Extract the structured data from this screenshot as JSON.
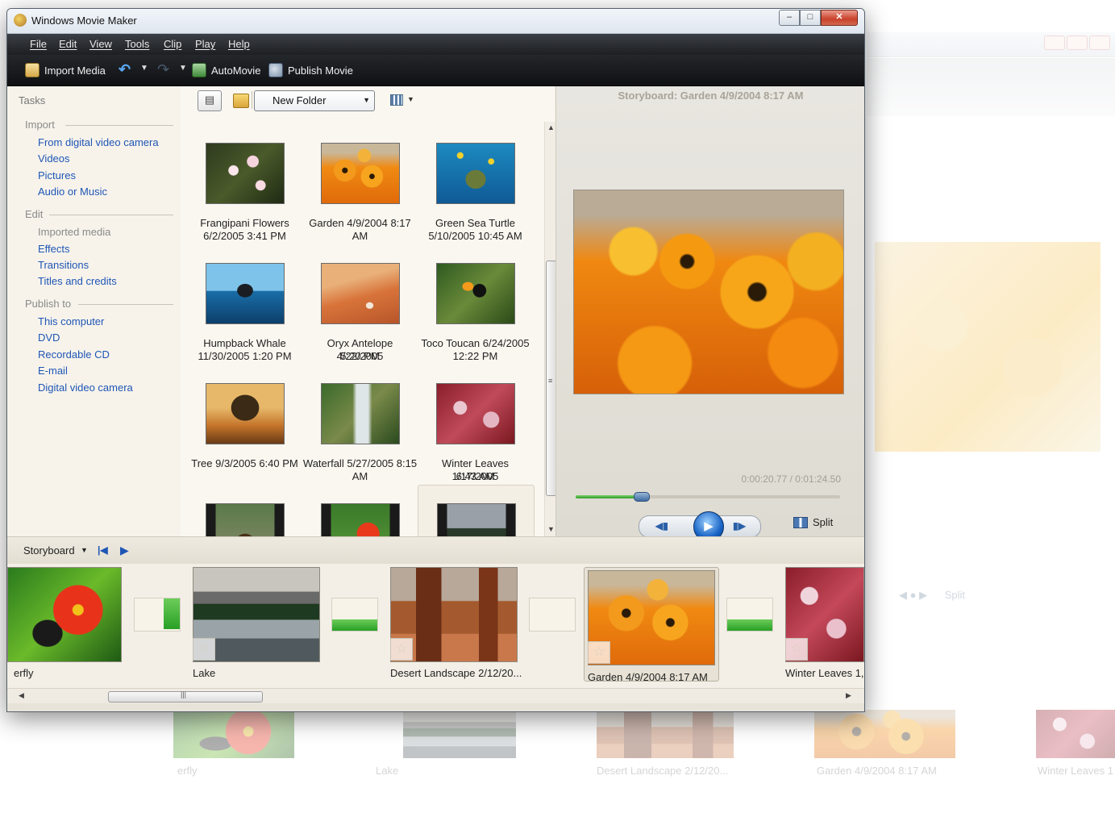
{
  "window": {
    "title": "Windows Movie Maker"
  },
  "menu": [
    "File",
    "Edit",
    "View",
    "Tools",
    "Clip",
    "Play",
    "Help"
  ],
  "toolbar": {
    "import_media": "Import Media",
    "automovie": "AutoMovie",
    "publish_movie": "Publish Movie"
  },
  "tasks": {
    "title": "Tasks",
    "import": {
      "heading": "Import",
      "items": [
        "From digital video camera",
        "Videos",
        "Pictures",
        "Audio or Music"
      ]
    },
    "edit": {
      "heading": "Edit",
      "items": [
        "Imported media",
        "Effects",
        "Transitions",
        "Titles and credits"
      ]
    },
    "publish": {
      "heading": "Publish to",
      "items": [
        "This computer",
        "DVD",
        "Recordable CD",
        "E-mail",
        "Digital video camera"
      ]
    }
  },
  "collection": {
    "folder": "New Folder",
    "items": [
      {
        "name": "Frangipani Flowers",
        "date": "6/2/2005 3:41 PM"
      },
      {
        "name": "Garden 4/9/2004 8:17",
        "date": "AM"
      },
      {
        "name": "Green Sea Turtle",
        "date": "5/10/2005 10:45 AM"
      },
      {
        "name": "Humpback Whale",
        "date": "11/30/2005 1:20 PM"
      },
      {
        "name": "Oryx Antelope 4/22/2005",
        "date": "5:20 PM"
      },
      {
        "name": "Toco Toucan 6/24/2005",
        "date": "12:22 PM"
      },
      {
        "name": "Tree 9/3/2005 6:40 PM",
        "date": ""
      },
      {
        "name": "Waterfall 5/27/2005 8:15",
        "date": "AM"
      },
      {
        "name": "Winter Leaves 1/17/2005",
        "date": "6:43 AM"
      }
    ]
  },
  "preview": {
    "title": "Storyboard: Garden 4/9/2004 8:17 AM",
    "time": "0:00:20.77 / 0:01:24.50",
    "progress": 0.246,
    "split": "Split"
  },
  "storyboard": {
    "label": "Storyboard",
    "clips": [
      {
        "label": "erfly"
      },
      {
        "label": "Lake"
      },
      {
        "label": "Desert Landscape 2/12/20..."
      },
      {
        "label": "Garden 4/9/2004 8:17 AM"
      },
      {
        "label": "Winter Leaves 1,"
      }
    ]
  },
  "reflection": {
    "labels": [
      "erfly",
      "Lake",
      "Desert Landscape 2/12/20...",
      "Garden 4/9/2004 8:17 AM",
      "Winter Leaves 1"
    ],
    "split": "Split"
  }
}
